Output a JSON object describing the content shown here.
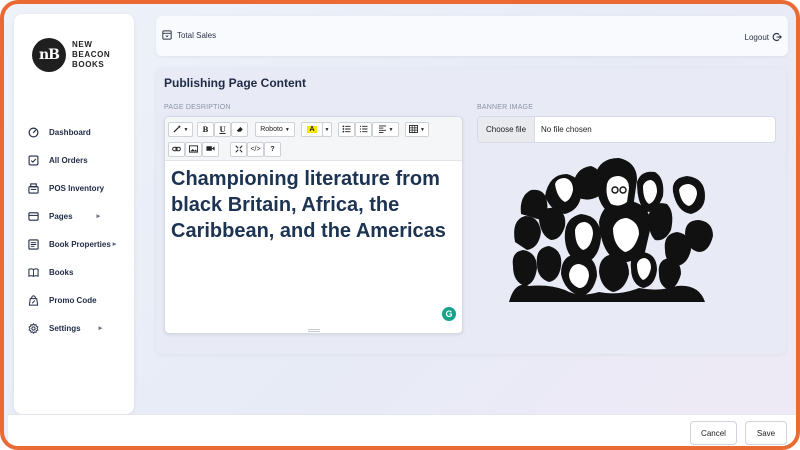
{
  "brand": {
    "monogram": "nB",
    "name_lines": [
      "NEW",
      "BEACON",
      "BOOKS"
    ]
  },
  "sidebar": {
    "items": [
      {
        "label": "Dashboard",
        "icon": "dashboard-gauge-icon"
      },
      {
        "label": "All Orders",
        "icon": "orders-check-icon"
      },
      {
        "label": "POS Inventory",
        "icon": "pos-inventory-icon"
      },
      {
        "label": "Pages",
        "icon": "pages-card-icon",
        "has_children": true
      },
      {
        "label": "Book Properties",
        "icon": "book-properties-icon",
        "has_children": true
      },
      {
        "label": "Books",
        "icon": "books-icon"
      },
      {
        "label": "Promo Code",
        "icon": "promo-code-icon"
      },
      {
        "label": "Settings",
        "icon": "settings-gear-icon",
        "has_children": true
      }
    ]
  },
  "header": {
    "total_sales_label": "Total Sales",
    "logout_label": "Logout"
  },
  "main": {
    "title": "Publishing Page Content",
    "page_description_label": "PAGE DESRIPTION",
    "banner_image_label": "BANNER IMAGE",
    "editor": {
      "font_name": "Roboto",
      "content": "Championing literature from black Britain, Africa, the Caribbean, and the Americas",
      "toolbar_labels": {
        "bold": "B",
        "underline": "U",
        "font_color": "A",
        "code_view": "</>",
        "help": "?"
      }
    },
    "file_input": {
      "button_label": "Choose file",
      "status_text": "No file chosen"
    }
  },
  "footer": {
    "cancel_label": "Cancel",
    "save_label": "Save"
  },
  "colors": {
    "frame_border": "#ea6a34",
    "heading_text": "#1c3352",
    "grammarly": "#15a38a"
  }
}
